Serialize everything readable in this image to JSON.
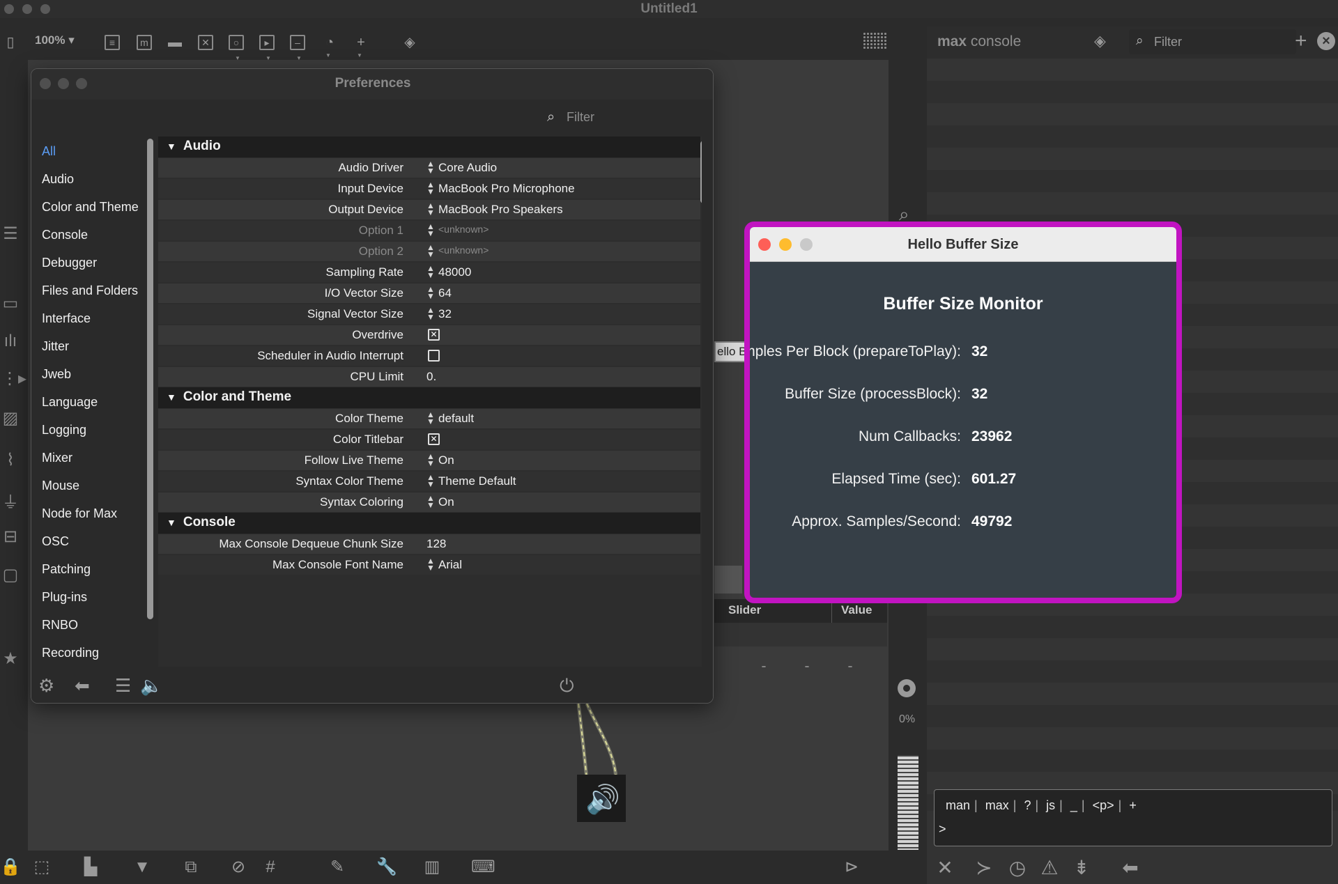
{
  "app": {
    "window_title": "Untitled1",
    "zoom": "100%"
  },
  "console": {
    "title_bold": "max",
    "title_rest": "console",
    "filter_placeholder": "Filter",
    "commands": [
      "man",
      "max",
      "?",
      "js",
      "_",
      "<p>",
      "+"
    ],
    "prompt": ">"
  },
  "preferences": {
    "title": "Preferences",
    "filter_placeholder": "Filter",
    "categories": [
      "All",
      "Audio",
      "Color and Theme",
      "Console",
      "Debugger",
      "Files and Folders",
      "Interface",
      "Jitter",
      "Jweb",
      "Language",
      "Logging",
      "Mixer",
      "Mouse",
      "Node for Max",
      "OSC",
      "Patching",
      "Plug-ins",
      "RNBO",
      "Recording"
    ],
    "selected_category": "All",
    "sections": {
      "audio": "Audio",
      "color_theme": "Color and Theme",
      "console": "Console"
    },
    "audio_rows": [
      {
        "label": "Audio Driver",
        "value": "Core Audio"
      },
      {
        "label": "Input Device",
        "value": "MacBook Pro Microphone"
      },
      {
        "label": "Output Device",
        "value": "MacBook Pro Speakers"
      },
      {
        "label": "Option 1",
        "value": "<unknown>"
      },
      {
        "label": "Option 2",
        "value": "<unknown>"
      },
      {
        "label": "Sampling Rate",
        "value": "48000"
      },
      {
        "label": "I/O Vector Size",
        "value": "64"
      },
      {
        "label": "Signal Vector Size",
        "value": "32"
      },
      {
        "label": "Overdrive",
        "value": "checked"
      },
      {
        "label": "Scheduler in Audio Interrupt",
        "value": "unchecked"
      },
      {
        "label": "CPU Limit",
        "value": "0."
      }
    ],
    "color_rows": [
      {
        "label": "Color Theme",
        "value": "default"
      },
      {
        "label": "Color Titlebar",
        "value": "checked"
      },
      {
        "label": "Follow Live Theme",
        "value": "On"
      },
      {
        "label": "Syntax Color Theme",
        "value": "Theme Default"
      },
      {
        "label": "Syntax Coloring",
        "value": "On"
      }
    ],
    "console_rows": [
      {
        "label": "Max Console Dequeue Chunk Size",
        "value": "128"
      },
      {
        "label": "Max Console Font Name",
        "value": "Arial"
      }
    ]
  },
  "patch": {
    "box_text": "ello B",
    "table_headers": [
      "Slider",
      "Value"
    ],
    "meter_percent": "0%"
  },
  "hello": {
    "title": "Hello Buffer Size",
    "heading": "Buffer Size Monitor",
    "rows": [
      {
        "label": "Samples Per Block (prepareToPlay):",
        "value": "32"
      },
      {
        "label": "Buffer Size (processBlock):",
        "value": "32"
      },
      {
        "label": "Num Callbacks:",
        "value": "23962"
      },
      {
        "label": "Elapsed Time (sec):",
        "value": "601.27"
      },
      {
        "label": "Approx. Samples/Second:",
        "value": "49792"
      }
    ],
    "accent_color": "#c114c1"
  }
}
